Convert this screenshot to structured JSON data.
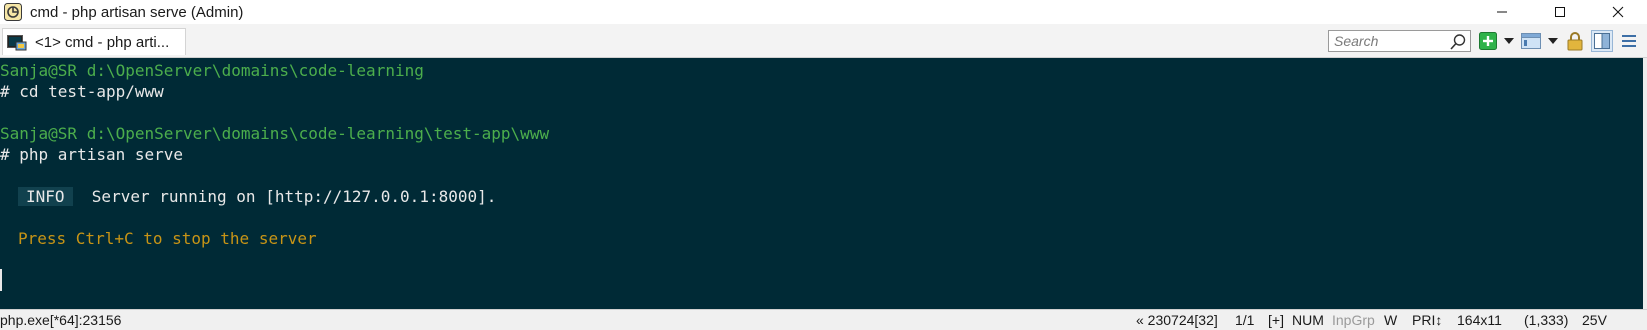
{
  "window": {
    "title": "cmd - php  artisan serve (Admin)",
    "app_icon": "conemu-icon",
    "controls": {
      "minimize": "minimize-icon",
      "maximize": "maximize-icon",
      "close": "close-icon"
    }
  },
  "tabs": [
    {
      "label": "<1> cmd - php  arti...",
      "icon": "console-tab-icon",
      "active": true
    }
  ],
  "toolbar": {
    "search_placeholder": "Search",
    "icons": [
      "search-icon",
      "new-console-icon",
      "dropdown-icon",
      "window-icon",
      "dropdown-icon",
      "lock-icon",
      "split-view-icon",
      "menu-icon"
    ]
  },
  "console": {
    "lines": [
      {
        "prompt_user": "Sanja@SR",
        "prompt_path": "d:\\OpenServer\\domains\\code-learning"
      },
      {
        "text": "# cd test-app/www"
      },
      {
        "text": ""
      },
      {
        "prompt_user": "Sanja@SR",
        "prompt_path": "d:\\OpenServer\\domains\\code-learning\\test-app\\www"
      },
      {
        "text": "# php artisan serve"
      },
      {
        "text": ""
      },
      {
        "badge": "INFO",
        "text": "Server running on [http://127.0.0.1:8000]."
      },
      {
        "text": ""
      },
      {
        "text": "Press Ctrl+C to stop the server"
      }
    ]
  },
  "statusbar": {
    "process": "php.exe[*64]:23156",
    "build": "« 230724[32]",
    "console_index": "1/1",
    "plus": "[+]",
    "num": "NUM",
    "inpgrp": "InpGrp",
    "w": "W",
    "pri": "PRI↕",
    "size": "164x11",
    "cursor_pos": "(1,333)",
    "encoding": "25V"
  },
  "colors": {
    "console_bg": "#002a36",
    "prompt_green": "#4cae4c",
    "notice_orange": "#c79416",
    "text": "#e8e8e8"
  }
}
